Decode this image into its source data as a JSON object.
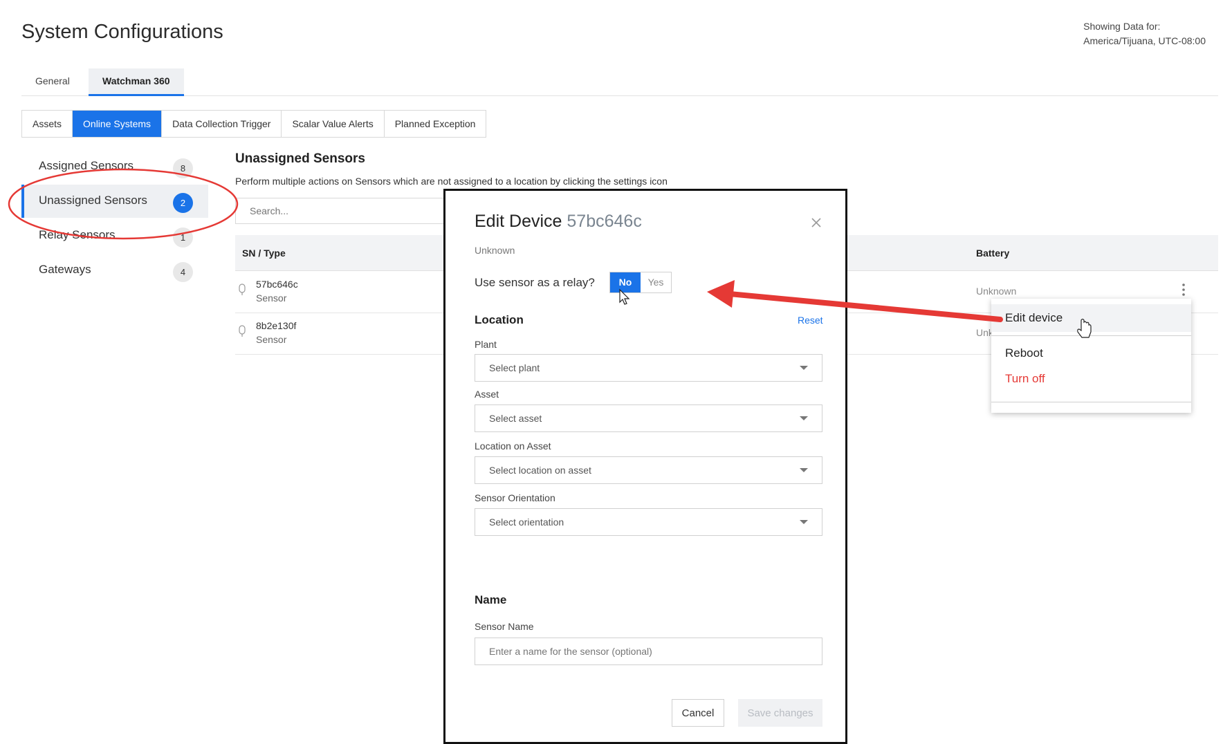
{
  "header": {
    "title": "System Configurations",
    "showing_label": "Showing Data for:",
    "timezone": "America/Tijuana, UTC-08:00"
  },
  "main_tabs": [
    {
      "label": "General",
      "active": false
    },
    {
      "label": "Watchman 360",
      "active": true
    }
  ],
  "sub_tabs": [
    {
      "label": "Assets",
      "active": false
    },
    {
      "label": "Online Systems",
      "active": true
    },
    {
      "label": "Data Collection Trigger",
      "active": false
    },
    {
      "label": "Scalar Value Alerts",
      "active": false
    },
    {
      "label": "Planned Exception",
      "active": false
    }
  ],
  "sidebar": {
    "items": [
      {
        "label": "Assigned Sensors",
        "count": "8",
        "active": false
      },
      {
        "label": "Unassigned Sensors",
        "count": "2",
        "active": true
      },
      {
        "label": "Relay Sensors",
        "count": "1",
        "active": false
      },
      {
        "label": "Gateways",
        "count": "4",
        "active": false
      }
    ]
  },
  "section": {
    "title": "Unassigned Sensors",
    "description": "Perform multiple actions on Sensors which are not assigned to a location by clicking the settings icon",
    "search_placeholder": "Search..."
  },
  "table": {
    "col_sn": "SN / Type",
    "col_battery": "Battery",
    "rows": [
      {
        "sn": "57bc646c",
        "type": "Sensor",
        "battery": "Unknown"
      },
      {
        "sn": "8b2e130f",
        "type": "Sensor",
        "battery": "Unk"
      }
    ]
  },
  "modal": {
    "title": "Edit Device",
    "device_id": "57bc646c",
    "status": "Unknown",
    "relay_question": "Use sensor as a relay?",
    "toggle_no": "No",
    "toggle_yes": "Yes",
    "location_heading": "Location",
    "reset": "Reset",
    "plant_label": "Plant",
    "plant_placeholder": "Select plant",
    "asset_label": "Asset",
    "asset_placeholder": "Select asset",
    "location_label": "Location on Asset",
    "location_placeholder": "Select location on asset",
    "orientation_label": "Sensor Orientation",
    "orientation_placeholder": "Select orientation",
    "name_heading": "Name",
    "sensor_name_label": "Sensor Name",
    "sensor_name_placeholder": "Enter a name for the sensor (optional)",
    "cancel": "Cancel",
    "save": "Save changes"
  },
  "menu": {
    "edit": "Edit device",
    "reboot": "Reboot",
    "turn_off": "Turn off"
  },
  "colors": {
    "accent": "#1a73e8",
    "danger": "#e53935",
    "annotation_red": "#e53935"
  }
}
